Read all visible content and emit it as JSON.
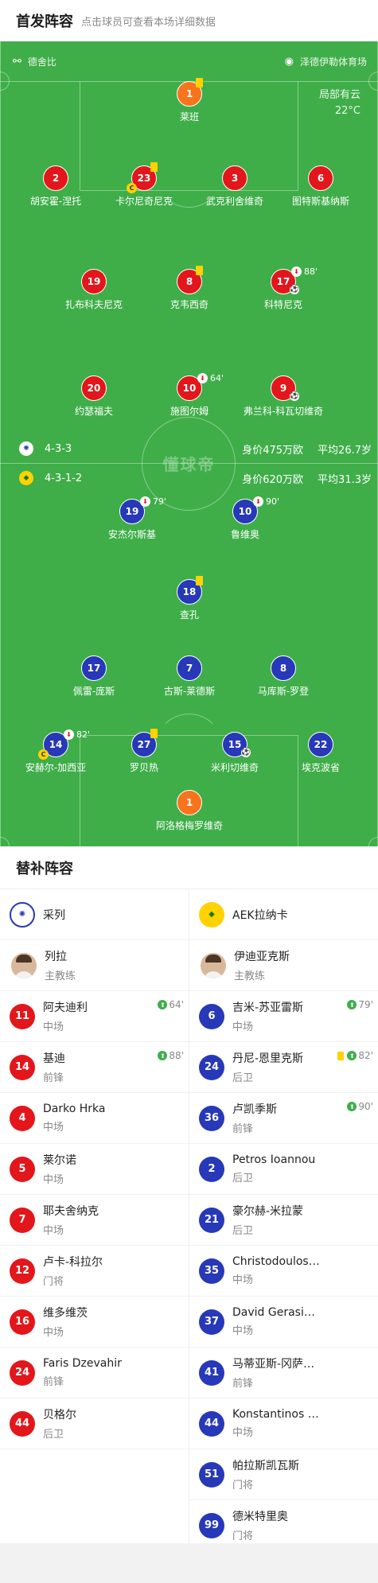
{
  "header": {
    "title": "首发阵容",
    "subtitle": "点击球员可查看本场详细数据"
  },
  "match_info": {
    "referee": "德舍比",
    "stadium": "泽德伊勒体育场",
    "weather": "局部有云",
    "temperature": "22°C"
  },
  "watermark": "懂球帝",
  "colors": {
    "pitch": "#3fae49",
    "home": "#e3161b",
    "away": "#2738b8",
    "goalkeeper": "#f7741c",
    "yellow_card": "#ffd200"
  },
  "home": {
    "formation": "4-3-3",
    "market_value": "身价475万欧",
    "avg_age": "平均26.7岁",
    "team_name": "采列",
    "coach": {
      "name": "列拉",
      "role": "主教练"
    },
    "lineup": [
      {
        "number": "1",
        "name": "莱班",
        "yellow": true
      },
      {
        "number": "2",
        "name": "胡安霍-涅托"
      },
      {
        "number": "23",
        "name": "卡尔尼奇尼克",
        "yellow": true,
        "captain": true
      },
      {
        "number": "3",
        "name": "武克利舍维奇"
      },
      {
        "number": "6",
        "name": "图特斯基纳斯"
      },
      {
        "number": "19",
        "name": "扎布科夫尼克"
      },
      {
        "number": "8",
        "name": "克韦西奇",
        "yellow": true
      },
      {
        "number": "17",
        "name": "科特尼克",
        "sub_minute": "88'"
      },
      {
        "number": "20",
        "name": "约瑟福夫"
      },
      {
        "number": "10",
        "name": "施图尔姆",
        "sub_minute": "64'"
      },
      {
        "number": "9",
        "name": "弗兰科-科瓦切维奇",
        "goal": true
      }
    ],
    "subs": [
      {
        "number": "11",
        "name": "阿夫迪利",
        "position": "中场",
        "in_minute": "64'"
      },
      {
        "number": "14",
        "name": "基迪",
        "position": "前锋",
        "in_minute": "88'"
      },
      {
        "number": "4",
        "name": "Darko Hrka",
        "position": "中场"
      },
      {
        "number": "5",
        "name": "莱尔诺",
        "position": "中场"
      },
      {
        "number": "7",
        "name": "耶夫舍纳克",
        "position": "中场"
      },
      {
        "number": "12",
        "name": "卢卡-科拉尔",
        "position": "门将"
      },
      {
        "number": "16",
        "name": "维多维茨",
        "position": "中场"
      },
      {
        "number": "24",
        "name": "Faris Dzevahir",
        "position": "前锋"
      },
      {
        "number": "44",
        "name": "贝格尔",
        "position": "后卫"
      }
    ]
  },
  "away": {
    "formation": "4-3-1-2",
    "market_value": "身价620万欧",
    "avg_age": "平均31.3岁",
    "team_name": "AEK拉纳卡",
    "coach": {
      "name": "伊迪亚克斯",
      "role": "主教练"
    },
    "lineup": [
      {
        "number": "19",
        "name": "安杰尔斯基",
        "sub_minute": "79'"
      },
      {
        "number": "10",
        "name": "鲁维奥",
        "sub_minute": "90'"
      },
      {
        "number": "18",
        "name": "查孔",
        "yellow": true
      },
      {
        "number": "17",
        "name": "佩雷-庞斯"
      },
      {
        "number": "7",
        "name": "古斯-莱德斯"
      },
      {
        "number": "8",
        "name": "马库斯-罗登"
      },
      {
        "number": "14",
        "name": "安赫尔-加西亚",
        "sub_minute": "82'",
        "captain": true
      },
      {
        "number": "27",
        "name": "罗贝热",
        "yellow": true
      },
      {
        "number": "15",
        "name": "米利切维奇",
        "goal": true
      },
      {
        "number": "22",
        "name": "埃克波省"
      },
      {
        "number": "1",
        "name": "阿洛格梅罗维奇"
      }
    ],
    "subs": [
      {
        "number": "6",
        "name": "吉米-苏亚雷斯",
        "position": "中场",
        "in_minute": "79'"
      },
      {
        "number": "24",
        "name": "丹尼-恩里克斯",
        "position": "后卫",
        "in_minute": "82'",
        "yellow": true
      },
      {
        "number": "36",
        "name": "卢凯季斯",
        "position": "前锋",
        "in_minute": "90'"
      },
      {
        "number": "2",
        "name": "Petros Ioannou",
        "position": "后卫"
      },
      {
        "number": "21",
        "name": "豪尔赫-米拉蒙",
        "position": "后卫"
      },
      {
        "number": "35",
        "name": "Christodoulos Ioannou",
        "position": "中场"
      },
      {
        "number": "37",
        "name": "David Gerasimou",
        "position": "中场"
      },
      {
        "number": "41",
        "name": "马蒂亚斯-冈萨雷斯",
        "position": "前锋"
      },
      {
        "number": "44",
        "name": "Konstantinos Panayi",
        "position": "中场"
      },
      {
        "number": "51",
        "name": "帕拉斯凯瓦斯",
        "position": "门将"
      },
      {
        "number": "99",
        "name": "德米特里奥",
        "position": "门将"
      }
    ]
  },
  "subs_title": "替补阵容"
}
